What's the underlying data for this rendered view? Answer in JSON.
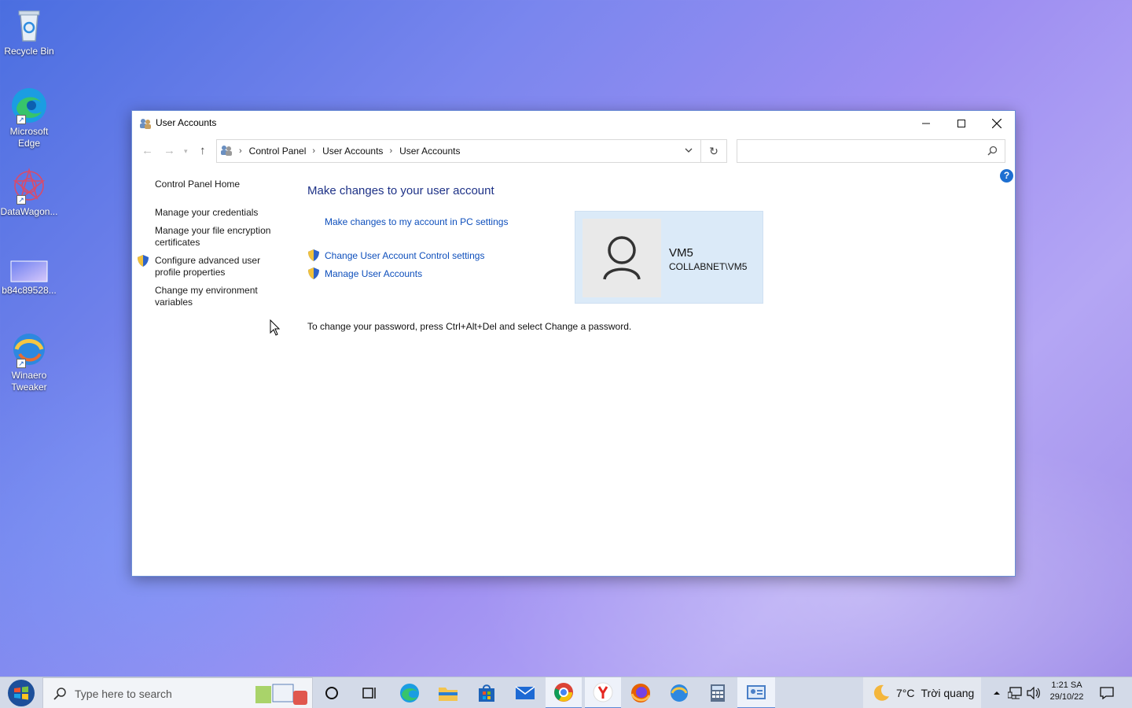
{
  "desktop": {
    "icons": [
      {
        "label": "Recycle Bin"
      },
      {
        "label": "Microsoft Edge"
      },
      {
        "label": "DataWagon..."
      },
      {
        "label": "b84c89528..."
      },
      {
        "label": "Winaero Tweaker"
      }
    ]
  },
  "window": {
    "title": "User Accounts",
    "breadcrumb": [
      "Control Panel",
      "User Accounts",
      "User Accounts"
    ],
    "search_placeholder": "",
    "help_label": "?"
  },
  "leftnav": {
    "home": "Control Panel Home",
    "items": [
      "Manage your credentials",
      "Manage your file encryption certificates",
      "Configure advanced user profile properties",
      "Change my environment variables"
    ]
  },
  "main": {
    "heading": "Make changes to your user account",
    "pc_settings_link": "Make changes to my account in PC settings",
    "uac_link": "Change User Account Control settings",
    "manage_link": "Manage User Accounts",
    "note": "To change your password, press Ctrl+Alt+Del and select Change a password."
  },
  "user": {
    "name": "VM5",
    "domain": "COLLABNET\\VM5"
  },
  "taskbar": {
    "search_placeholder": "Type here to search",
    "weather_temp": "7°C",
    "weather_desc": "Trời quang",
    "time": "1:21 SA",
    "date": "29/10/22"
  },
  "colors": {
    "link": "#0e4fbc",
    "heading": "#1e3287",
    "user_card": "#dbeaf8"
  }
}
